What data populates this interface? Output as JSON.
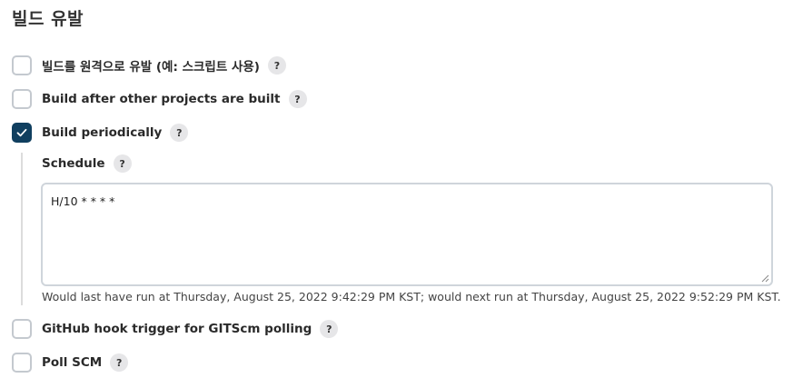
{
  "section": {
    "title": "빌드 유발"
  },
  "triggers": [
    {
      "label": "빌드를 원격으로 유발 (예: 스크립트 사용)",
      "checked": false,
      "help": "?"
    },
    {
      "label": "Build after other projects are built",
      "checked": false,
      "help": "?"
    },
    {
      "label": "Build periodically",
      "checked": true,
      "help": "?"
    },
    {
      "label": "GitHub hook trigger for GITScm polling",
      "checked": false,
      "help": "?"
    },
    {
      "label": "Poll SCM",
      "checked": false,
      "help": "?"
    }
  ],
  "schedule": {
    "label": "Schedule",
    "help": "?",
    "value": "H/10 * * * *",
    "info": "Would last have run at Thursday, August 25, 2022 9:42:29 PM KST; would next run at Thursday, August 25, 2022 9:52:29 PM KST."
  },
  "colors": {
    "checkbox_checked": "#103f5f",
    "checkbox_border": "#c4c9cf",
    "help_bg": "#e6e6e8"
  }
}
